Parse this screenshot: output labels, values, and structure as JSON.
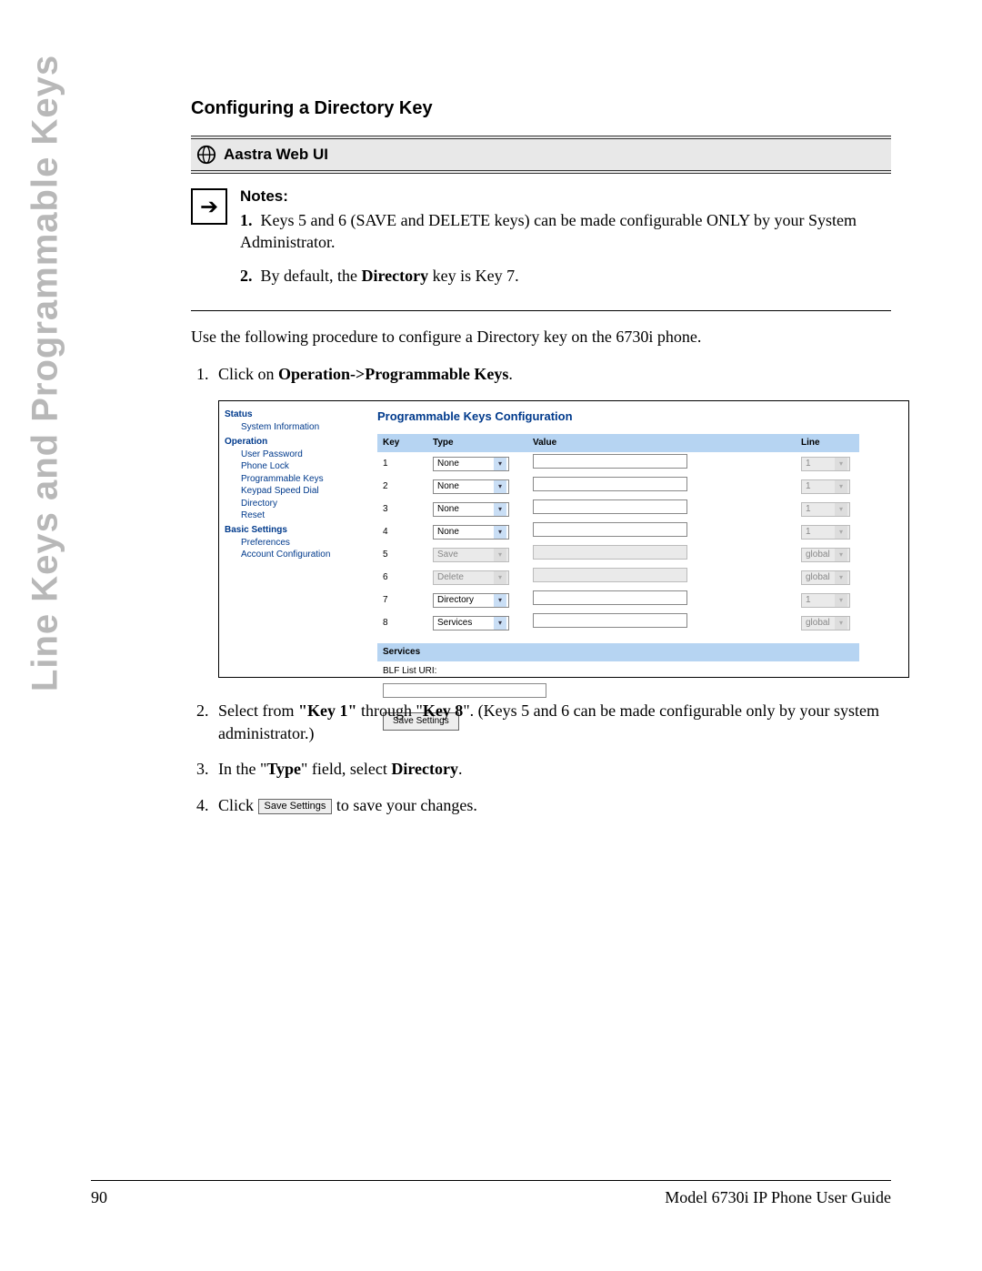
{
  "side_title": "Line Keys and Programmable Keys",
  "section_title": "Configuring a Directory Key",
  "webui": {
    "label": "Aastra Web UI"
  },
  "notes": {
    "heading": "Notes:",
    "n1_num": "1.",
    "n1_text": "Keys 5 and 6 (SAVE and DELETE keys) can be made configurable ONLY by your System Administrator.",
    "n2_num": "2.",
    "n2_a": "By default, the ",
    "n2_bold": "Directory",
    "n2_b": " key is Key 7."
  },
  "intro": "Use the following procedure to configure a Directory key on the 6730i phone.",
  "steps": {
    "s1_a": "Click on ",
    "s1_bold": "Operation->Programmable Keys",
    "s1_b": ".",
    "s2_a": "Select from ",
    "s2_bold1": "\"Key 1\"",
    "s2_mid": " through \"",
    "s2_bold2": "Key 8",
    "s2_b": "\". (Keys 5 and 6 can be made configurable only by your system administrator.)",
    "s3_a": "In the \"",
    "s3_bold1": "Type",
    "s3_mid": "\" field, select ",
    "s3_bold2": "Directory",
    "s3_b": ".",
    "s4_a": "Click ",
    "s4_btn": "Save Settings",
    "s4_b": " to save your changes."
  },
  "screenshot": {
    "title": "Programmable Keys Configuration",
    "sidebar": {
      "status": "Status",
      "sysinfo": "System Information",
      "operation": "Operation",
      "userpw": "User Password",
      "phonelock": "Phone Lock",
      "progkeys": "Programmable Keys",
      "keypad": "Keypad Speed Dial",
      "directory": "Directory",
      "reset": "Reset",
      "basic": "Basic Settings",
      "prefs": "Preferences",
      "acct": "Account Configuration"
    },
    "headers": {
      "key": "Key",
      "type": "Type",
      "value": "Value",
      "line": "Line"
    },
    "rows": [
      {
        "key": "1",
        "type": "None",
        "type_enabled": true,
        "value_enabled": true,
        "line": "1",
        "line_enabled": false
      },
      {
        "key": "2",
        "type": "None",
        "type_enabled": true,
        "value_enabled": true,
        "line": "1",
        "line_enabled": false
      },
      {
        "key": "3",
        "type": "None",
        "type_enabled": true,
        "value_enabled": true,
        "line": "1",
        "line_enabled": false
      },
      {
        "key": "4",
        "type": "None",
        "type_enabled": true,
        "value_enabled": true,
        "line": "1",
        "line_enabled": false
      },
      {
        "key": "5",
        "type": "Save",
        "type_enabled": false,
        "value_enabled": false,
        "line": "global",
        "line_enabled": false
      },
      {
        "key": "6",
        "type": "Delete",
        "type_enabled": false,
        "value_enabled": false,
        "line": "global",
        "line_enabled": false
      },
      {
        "key": "7",
        "type": "Directory",
        "type_enabled": true,
        "value_enabled": true,
        "line": "1",
        "line_enabled": false
      },
      {
        "key": "8",
        "type": "Services",
        "type_enabled": true,
        "value_enabled": true,
        "line": "global",
        "line_enabled": false
      }
    ],
    "services_header": "Services",
    "blf_label": "BLF List URI:",
    "save_btn": "Save Settings"
  },
  "footer": {
    "page": "90",
    "title": "Model 6730i IP Phone User Guide"
  }
}
